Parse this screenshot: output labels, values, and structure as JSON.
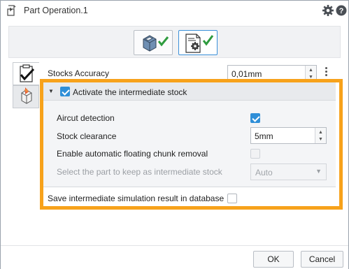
{
  "window": {
    "title": "Part Operation.1",
    "icons": [
      "part-operation-icon",
      "gear-icon",
      "help-icon"
    ]
  },
  "mode_buttons": [
    {
      "icon": "part-geometry-check-icon",
      "active": false
    },
    {
      "icon": "settings-document-check-icon",
      "active": true
    }
  ],
  "tabs": [
    {
      "icon": "clipboard-check-icon",
      "selected": true
    },
    {
      "icon": "stock-part-icon",
      "selected": false
    }
  ],
  "stocks_accuracy": {
    "label": "Stocks Accuracy",
    "value": "0,01mm"
  },
  "intermediate_stock": {
    "label": "Activate the intermediate stock",
    "checked": true,
    "aircut": {
      "label": "Aircut detection",
      "checked": true
    },
    "stock_clearance": {
      "label": "Stock clearance",
      "value": "5mm"
    },
    "floating_chunk": {
      "label": "Enable automatic floating chunk removal",
      "checked": false
    },
    "part_select": {
      "label": "Select the part to keep as intermediate stock",
      "value": "Auto",
      "enabled": false
    }
  },
  "save_result": {
    "label": "Save intermediate simulation result in database",
    "checked": false
  },
  "footer": {
    "ok_label": "OK",
    "cancel_label": "Cancel"
  },
  "colors": {
    "highlight": "#f7a21b",
    "accent": "#2f8fd8",
    "check_green": "#2e9b3e"
  }
}
